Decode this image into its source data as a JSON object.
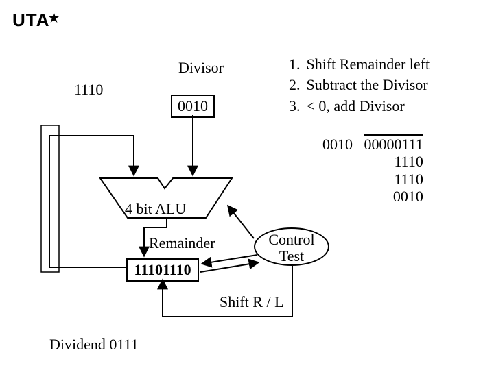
{
  "logo": "UTA",
  "labels": {
    "divisor": "Divisor",
    "inverted": "1110",
    "divisor_value": "0010",
    "alu": "4 bit ALU",
    "remainder": "Remainder",
    "remainder_value": "11101110",
    "control": "Control Test",
    "shift": "Shift R / L",
    "dividend": "Dividend 0111"
  },
  "steps": {
    "s1_num": "1.",
    "s1_text": "Shift Remainder left",
    "s2_num": "2.",
    "s2_text": "Subtract the Divisor",
    "s3_num": "3.",
    "s3_text": "< 0, add Divisor"
  },
  "worked": {
    "quotient": "0010",
    "dividend_bits": "00000111",
    "line1": "1110",
    "line2": "1110",
    "line3": "0010"
  },
  "chart_data": {
    "type": "diagram",
    "title": "4-bit division datapath step",
    "dividend": "0111",
    "divisor": "0010",
    "divisor_twos_complement": "1110",
    "remainder_register": "11101110",
    "alu_width_bits": 4,
    "algorithm_steps": [
      "Shift Remainder left",
      "Subtract the Divisor",
      "< 0, add Divisor"
    ],
    "long_division_trace": {
      "quotient": "0010",
      "dividend_bits": "00000111",
      "partial_results": [
        "1110",
        "1110",
        "0010"
      ]
    },
    "blocks": [
      "Divisor register",
      "4 bit ALU",
      "Remainder register",
      "Control Test"
    ],
    "edges": [
      [
        "Divisor register",
        "4 bit ALU"
      ],
      [
        "Remainder register",
        "4 bit ALU"
      ],
      [
        "4 bit ALU",
        "Remainder register"
      ],
      [
        "Control Test",
        "4 bit ALU"
      ],
      [
        "Control Test",
        "Remainder register"
      ],
      [
        "Remainder register",
        "Control Test"
      ]
    ],
    "shift_control": "Shift R / L"
  }
}
